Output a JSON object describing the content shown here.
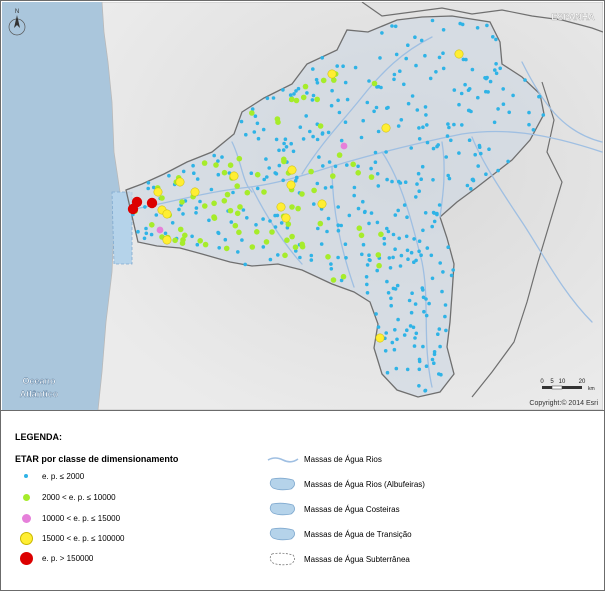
{
  "map": {
    "country_label": "ESPANHA",
    "ocean_label_line1": "Oceano",
    "ocean_label_line2": "Atlântico",
    "north_symbol": "N",
    "scale_ticks": [
      "0",
      "5",
      "10",
      "20"
    ],
    "scale_unit": "km",
    "copyright": "Copyright:© 2014 Esri",
    "colors": {
      "sea": "#aac6dc",
      "land": "#e6e6e6",
      "basin": "#cfd8e4",
      "river": "#9fbfe2",
      "border": "#6f6f6f",
      "small": "#2fb3e6",
      "medium": "#a6ec2a",
      "pink": "#e680da",
      "large": "#ffee33",
      "xlarge": "#dc0000"
    }
  },
  "legend": {
    "title": "LEGENDA:",
    "subtitle": "ETAR por classe de dimensionamento",
    "classes": [
      {
        "label": "e. p.  ≤ 2000",
        "color": "#2fb3e6",
        "size": 4
      },
      {
        "label": "2000 < e. p.  ≤ 10000",
        "color": "#a6ec2a",
        "size": 7
      },
      {
        "label": "10000 < e. p.  ≤ 15000",
        "color": "#e680da",
        "size": 9
      },
      {
        "label": "15000 < e. p.  ≤ 100000",
        "color": "#ffee33",
        "size": 11
      },
      {
        "label": "e. p. > 150000",
        "color": "#dc0000",
        "size": 13
      }
    ],
    "water_bodies": [
      {
        "label": "Massas de Água Rios"
      },
      {
        "label": "Massas de Água Rios (Albufeiras)"
      },
      {
        "label": "Massas de Água Costeiras"
      },
      {
        "label": "Massas de Água de Transição"
      },
      {
        "label": "Massas de Água Subterrânea"
      }
    ]
  }
}
